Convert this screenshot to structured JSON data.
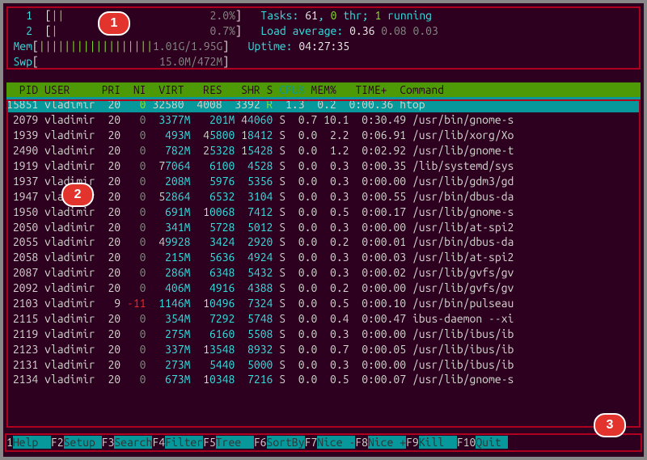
{
  "badges": {
    "one": "1",
    "two": "2",
    "three": "3"
  },
  "summary": {
    "cpu1_label": "1",
    "cpu1_bar": "||",
    "cpu1_pct": "2.0%",
    "cpu2_label": "2",
    "cpu2_bar": "|",
    "cpu2_pct": "0.7%",
    "mem_label": "Mem",
    "mem_bar": "||||||||||||||||||",
    "mem_txt": "1.01G/1.95G",
    "swp_label": "Swp",
    "swp_bar": "",
    "swp_txt": "15.0M/472M",
    "tasks_l": "Tasks: ",
    "tasks_n": "61",
    "tasks_c1": ", ",
    "thr_n": "0",
    "thr_t": " thr; ",
    "run_n": "1",
    "run_t": " running",
    "la_l": "Load average: ",
    "la1": "0.36",
    "la2": "0.08",
    "la3": "0.03",
    "up_l": "Uptime: ",
    "up_v": "04:27:35"
  },
  "header": {
    "pid": "  PID",
    "user": "USER",
    "pri": "PRI",
    "ni": " NI",
    "virt": " VIRT",
    "res": "  RES",
    "shr": "  SHR",
    "s": "S",
    "cpu": "CPU%",
    "mem": "MEM%",
    "time": "  TIME+ ",
    "cmd": "Command"
  },
  "rows": [
    {
      "pid": "15851",
      "user": "vladimir",
      "pri": "20",
      "ni": "  0",
      "virt": [
        "",
        "32580"
      ],
      "res": [
        "",
        " 4008"
      ],
      "shr": [
        "",
        " 3392"
      ],
      "s": "R",
      "cpu": " 1.3",
      "mem": " 0.2",
      "time": " 0:00.36",
      "cmd": "htop",
      "sel": true
    },
    {
      "pid": " 2079",
      "user": "vladimir",
      "pri": "20",
      "ni": "  0",
      "virt": [
        " ",
        "3377M"
      ],
      "res": [
        "  ",
        "201M"
      ],
      "shr": [
        "4",
        "4060"
      ],
      "s": "S",
      "cpu": " 0.7",
      "mem": "10.1",
      "time": " 0:30.49",
      "cmd": "/usr/bin/gnome-s"
    },
    {
      "pid": " 1939",
      "user": "vladimir",
      "pri": "20",
      "ni": "  0",
      "virt": [
        "  ",
        "493M"
      ],
      "res": [
        " 4",
        "5800"
      ],
      "shr": [
        "1",
        "8412"
      ],
      "s": "S",
      "cpu": " 0.0",
      "mem": " 2.2",
      "time": " 0:06.91",
      "cmd": "/usr/lib/xorg/Xo"
    },
    {
      "pid": " 2490",
      "user": "vladimir",
      "pri": "20",
      "ni": "  0",
      "virt": [
        "  ",
        "782M"
      ],
      "res": [
        " 2",
        "5328"
      ],
      "shr": [
        "1",
        "5428"
      ],
      "s": "S",
      "cpu": " 0.0",
      "mem": " 1.2",
      "time": " 0:02.92",
      "cmd": "/usr/lib/gnome-t"
    },
    {
      "pid": " 1919",
      "user": "vladimir",
      "pri": "20",
      "ni": "  0",
      "virt": [
        " 7",
        "7064"
      ],
      "res": [
        "  ",
        "6100"
      ],
      "shr": [
        " ",
        "4528"
      ],
      "s": "S",
      "cpu": " 0.0",
      "mem": " 0.3",
      "time": " 0:00.35",
      "cmd": "/lib/systemd/sys"
    },
    {
      "pid": " 1937",
      "user": "vladimir",
      "pri": "20",
      "ni": "  0",
      "virt": [
        "  ",
        "208M"
      ],
      "res": [
        "  ",
        "5976"
      ],
      "shr": [
        " ",
        "5356"
      ],
      "s": "S",
      "cpu": " 0.0",
      "mem": " 0.3",
      "time": " 0:00.00",
      "cmd": "/usr/lib/gdm3/gd"
    },
    {
      "pid": " 1947",
      "user": "vladimir",
      "pri": "20",
      "ni": "  0",
      "virt": [
        " 5",
        "2864"
      ],
      "res": [
        "  ",
        "6532"
      ],
      "shr": [
        " ",
        "3104"
      ],
      "s": "S",
      "cpu": " 0.0",
      "mem": " 0.3",
      "time": " 0:00.55",
      "cmd": "/usr/bin/dbus-da"
    },
    {
      "pid": " 1950",
      "user": "vladimir",
      "pri": "20",
      "ni": "  0",
      "virt": [
        "  ",
        "691M"
      ],
      "res": [
        " 1",
        "0068"
      ],
      "shr": [
        " ",
        "7412"
      ],
      "s": "S",
      "cpu": " 0.0",
      "mem": " 0.5",
      "time": " 0:00.17",
      "cmd": "/usr/lib/gnome-s"
    },
    {
      "pid": " 2050",
      "user": "vladimir",
      "pri": "20",
      "ni": "  0",
      "virt": [
        "  ",
        "341M"
      ],
      "res": [
        "  ",
        "5728"
      ],
      "shr": [
        " ",
        "5012"
      ],
      "s": "S",
      "cpu": " 0.0",
      "mem": " 0.3",
      "time": " 0:00.00",
      "cmd": "/usr/lib/at-spi2"
    },
    {
      "pid": " 2055",
      "user": "vladimir",
      "pri": "20",
      "ni": "  0",
      "virt": [
        " 4",
        "9928"
      ],
      "res": [
        "  ",
        "3424"
      ],
      "shr": [
        " ",
        "2920"
      ],
      "s": "S",
      "cpu": " 0.0",
      "mem": " 0.2",
      "time": " 0:00.01",
      "cmd": "/usr/bin/dbus-da"
    },
    {
      "pid": " 2058",
      "user": "vladimir",
      "pri": "20",
      "ni": "  0",
      "virt": [
        "  ",
        "215M"
      ],
      "res": [
        "  ",
        "5636"
      ],
      "shr": [
        " ",
        "4924"
      ],
      "s": "S",
      "cpu": " 0.0",
      "mem": " 0.3",
      "time": " 0:00.03",
      "cmd": "/usr/lib/at-spi2"
    },
    {
      "pid": " 2087",
      "user": "vladimir",
      "pri": "20",
      "ni": "  0",
      "virt": [
        "  ",
        "286M"
      ],
      "res": [
        "  ",
        "6348"
      ],
      "shr": [
        " ",
        "5432"
      ],
      "s": "S",
      "cpu": " 0.0",
      "mem": " 0.3",
      "time": " 0:00.02",
      "cmd": "/usr/lib/gvfs/gv"
    },
    {
      "pid": " 2092",
      "user": "vladimir",
      "pri": "20",
      "ni": "  0",
      "virt": [
        "  ",
        "406M"
      ],
      "res": [
        "  ",
        "4916"
      ],
      "shr": [
        " ",
        "4388"
      ],
      "s": "S",
      "cpu": " 0.0",
      "mem": " 0.2",
      "time": " 0:00.00",
      "cmd": "/usr/lib/gvfs/gv"
    },
    {
      "pid": " 2103",
      "user": "vladimir",
      "pri": " 9",
      "ni": "-11",
      "virt": [
        " ",
        "1146M"
      ],
      "res": [
        " 1",
        "0496"
      ],
      "shr": [
        " ",
        "7324"
      ],
      "s": "S",
      "cpu": " 0.0",
      "mem": " 0.5",
      "time": " 0:00.10",
      "cmd": "/usr/bin/pulseau"
    },
    {
      "pid": " 2115",
      "user": "vladimir",
      "pri": "20",
      "ni": "  0",
      "virt": [
        "  ",
        "354M"
      ],
      "res": [
        "  ",
        "7292"
      ],
      "shr": [
        " ",
        "5748"
      ],
      "s": "S",
      "cpu": " 0.0",
      "mem": " 0.4",
      "time": " 0:00.47",
      "cmd": "ibus-daemon --xi"
    },
    {
      "pid": " 2119",
      "user": "vladimir",
      "pri": "20",
      "ni": "  0",
      "virt": [
        "  ",
        "275M"
      ],
      "res": [
        "  ",
        "6160"
      ],
      "shr": [
        " ",
        "5508"
      ],
      "s": "S",
      "cpu": " 0.0",
      "mem": " 0.3",
      "time": " 0:00.00",
      "cmd": "/usr/lib/ibus/ib"
    },
    {
      "pid": " 2123",
      "user": "vladimir",
      "pri": "20",
      "ni": "  0",
      "virt": [
        "  ",
        "337M"
      ],
      "res": [
        " 1",
        "3548"
      ],
      "shr": [
        " ",
        "8932"
      ],
      "s": "S",
      "cpu": " 0.0",
      "mem": " 0.7",
      "time": " 0:00.05",
      "cmd": "/usr/lib/ibus/ib"
    },
    {
      "pid": " 2131",
      "user": "vladimir",
      "pri": "20",
      "ni": "  0",
      "virt": [
        "  ",
        "273M"
      ],
      "res": [
        "  ",
        "5440"
      ],
      "shr": [
        " ",
        "5000"
      ],
      "s": "S",
      "cpu": " 0.0",
      "mem": " 0.3",
      "time": " 0:00.00",
      "cmd": "/usr/lib/ibus/ib"
    },
    {
      "pid": " 2134",
      "user": "vladimir",
      "pri": "20",
      "ni": "  0",
      "virt": [
        "  ",
        "673M"
      ],
      "res": [
        " 1",
        "0348"
      ],
      "shr": [
        " ",
        "7216"
      ],
      "s": "S",
      "cpu": " 0.0",
      "mem": " 0.5",
      "time": " 0:00.07",
      "cmd": "/usr/lib/gnome-s"
    }
  ],
  "footer": [
    {
      "k": "1",
      "v": "Help  "
    },
    {
      "k": "F2",
      "v": "Setup "
    },
    {
      "k": "F3",
      "v": "Search"
    },
    {
      "k": "F4",
      "v": "Filter"
    },
    {
      "k": "F5",
      "v": "Tree  "
    },
    {
      "k": "F6",
      "v": "SortBy"
    },
    {
      "k": "F7",
      "v": "Nice -"
    },
    {
      "k": "F8",
      "v": "Nice +"
    },
    {
      "k": "F9",
      "v": "Kill  "
    },
    {
      "k": "F10",
      "v": "Quit "
    }
  ]
}
